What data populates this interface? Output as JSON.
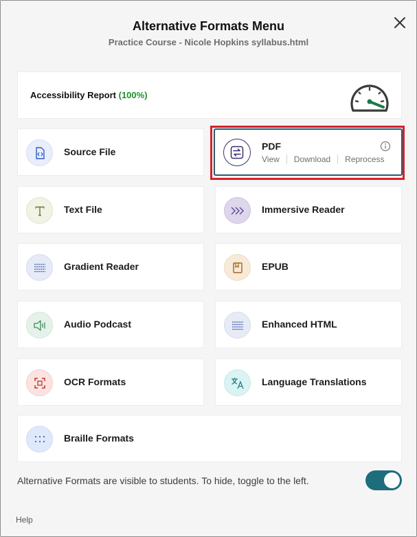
{
  "dialog": {
    "title": "Alternative Formats Menu",
    "subtitle": "Practice Course - Nicole Hopkins syllabus.html",
    "close_icon": "close-icon"
  },
  "report": {
    "label": "Accessibility Report",
    "score": "(100%)",
    "icon": "gauge-icon",
    "score_color": "#1f8f2a"
  },
  "formats": {
    "source_file": {
      "label": "Source File",
      "icon": "code-file-icon"
    },
    "pdf": {
      "label": "PDF",
      "icon": "convert-icon",
      "actions": [
        "View",
        "Download",
        "Reprocess"
      ],
      "info_icon": "info-icon"
    },
    "text_file": {
      "label": "Text File",
      "icon": "text-icon"
    },
    "immersive_reader": {
      "label": "Immersive Reader",
      "icon": "chevrons-right-icon"
    },
    "gradient_reader": {
      "label": "Gradient Reader",
      "icon": "lines-icon"
    },
    "epub": {
      "label": "EPUB",
      "icon": "book-icon"
    },
    "audio_podcast": {
      "label": "Audio Podcast",
      "icon": "speaker-icon"
    },
    "enhanced_html": {
      "label": "Enhanced HTML",
      "icon": "lines-icon"
    },
    "ocr_formats": {
      "label": "OCR Formats",
      "icon": "scan-icon"
    },
    "language_translations": {
      "label": "Language Translations",
      "icon": "translate-icon"
    },
    "braille_formats": {
      "label": "Braille Formats",
      "icon": "braille-dots-icon"
    }
  },
  "footer": {
    "visibility_text": "Alternative Formats are visible to students. To hide, toggle to the left.",
    "toggle_on": true,
    "help_label": "Help"
  },
  "colors": {
    "highlight": "#d4222a",
    "toggle": "#1e6d7d",
    "pdf_border": "#2a5a6d"
  }
}
